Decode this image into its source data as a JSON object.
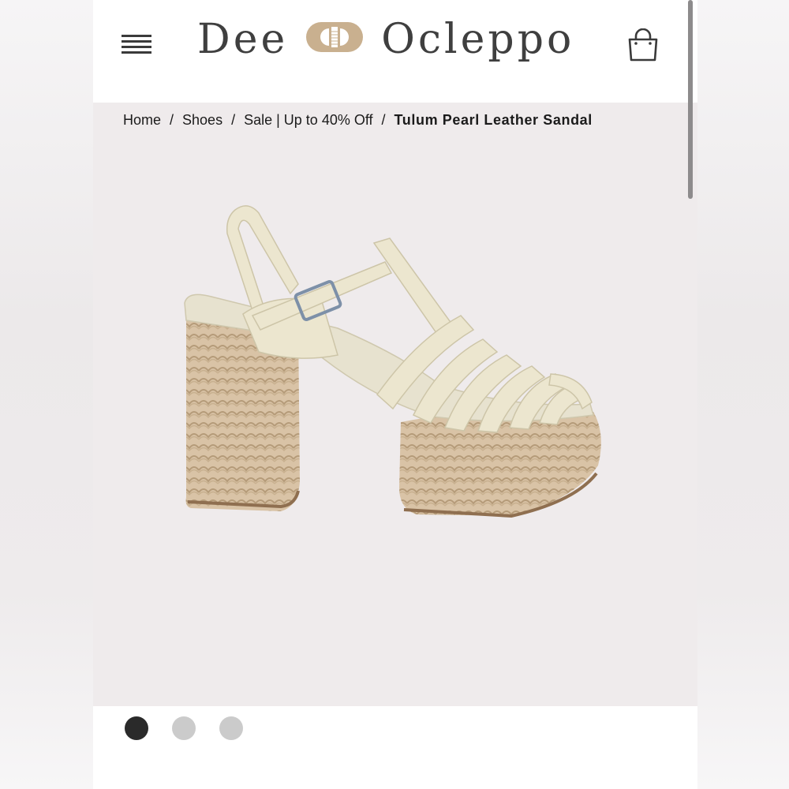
{
  "header": {
    "brand_left": "Dee",
    "brand_right": "Ocleppo"
  },
  "breadcrumb": {
    "items": [
      "Home",
      "Shoes",
      "Sale | Up to 40% Off"
    ],
    "separator": "/",
    "current": "Tulum Pearl Leather Sandal"
  },
  "gallery": {
    "slide_count": 3,
    "active_index": 0
  },
  "icons": {
    "menu": "hamburger-menu-icon",
    "cart": "shopping-bag-icon",
    "logo_mark": "buckle-logo-mark"
  },
  "colors": {
    "accent_gold": "#c9b08f",
    "text_dark": "#3f3f3f",
    "stage_bg": "#efebec"
  }
}
